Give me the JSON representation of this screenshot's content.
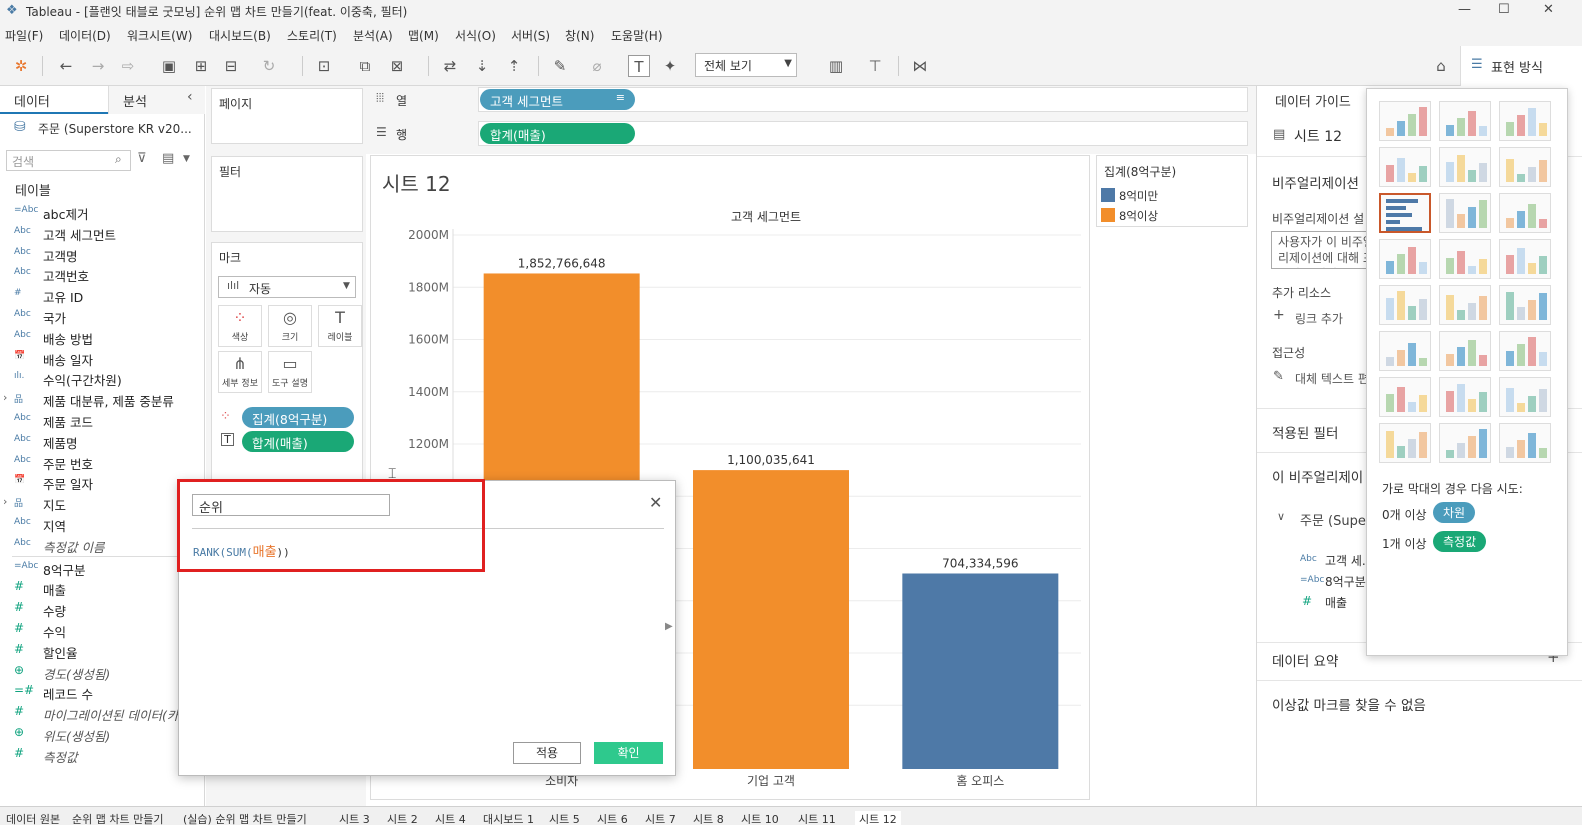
{
  "window": {
    "title": "Tableau - [플랜잇 태블로 굿모닝] 순위 맵 차트 만들기(feat. 이중축, 필터)"
  },
  "menu": [
    "파일(F)",
    "데이터(D)",
    "워크시트(W)",
    "대시보드(B)",
    "스토리(T)",
    "분석(A)",
    "맵(M)",
    "서식(O)",
    "서버(S)",
    "창(N)",
    "도움말(H)"
  ],
  "toolbar": {
    "view_select": "전체 보기",
    "show_me_label": "표현 방식"
  },
  "left": {
    "tab_data": "데이터",
    "tab_analysis": "분석",
    "datasource": "주문 (Superstore KR v20...",
    "search_placeholder": "검색",
    "tables_title": "테이블",
    "fields": [
      {
        "icon": "=Abc",
        "name": "abc제거",
        "kind": "dim"
      },
      {
        "icon": "Abc",
        "name": "고객 세그먼트",
        "kind": "dim"
      },
      {
        "icon": "Abc",
        "name": "고객명",
        "kind": "dim"
      },
      {
        "icon": "Abc",
        "name": "고객번호",
        "kind": "dim"
      },
      {
        "icon": "#",
        "name": "고유 ID",
        "kind": "dim"
      },
      {
        "icon": "Abc",
        "name": "국가",
        "kind": "dim"
      },
      {
        "icon": "Abc",
        "name": "배송 방법",
        "kind": "dim"
      },
      {
        "icon": "📅",
        "name": "배송 일자",
        "kind": "dim"
      },
      {
        "icon": "ılı.",
        "name": "수익(구간차원)",
        "kind": "dim"
      },
      {
        "icon": "品",
        "name": "제품 대분류, 제품 중분류",
        "kind": "dim",
        "expand": true
      },
      {
        "icon": "Abc",
        "name": "제품 코드",
        "kind": "dim"
      },
      {
        "icon": "Abc",
        "name": "제품명",
        "kind": "dim"
      },
      {
        "icon": "Abc",
        "name": "주문 번호",
        "kind": "dim"
      },
      {
        "icon": "📅",
        "name": "주문 일자",
        "kind": "dim"
      },
      {
        "icon": "品",
        "name": "지도",
        "kind": "dim",
        "expand": true
      },
      {
        "icon": "Abc",
        "name": "지역",
        "kind": "dim"
      },
      {
        "icon": "Abc",
        "name": "측정값 이름",
        "kind": "dim",
        "italic": true
      },
      {
        "icon": "=Abc",
        "name": "8억구분",
        "kind": "dim"
      },
      {
        "icon": "#",
        "name": "매출",
        "kind": "mea"
      },
      {
        "icon": "#",
        "name": "수량",
        "kind": "mea"
      },
      {
        "icon": "#",
        "name": "수익",
        "kind": "mea"
      },
      {
        "icon": "#",
        "name": "할인율",
        "kind": "mea"
      },
      {
        "icon": "⊕",
        "name": "경도(생성됨)",
        "kind": "mea",
        "italic": true
      },
      {
        "icon": "=#",
        "name": "레코드 수",
        "kind": "mea"
      },
      {
        "icon": "#",
        "name": "마이그레이션된 데이터(카",
        "kind": "mea",
        "italic": true
      },
      {
        "icon": "⊕",
        "name": "위도(생성됨)",
        "kind": "mea",
        "italic": true
      },
      {
        "icon": "#",
        "name": "측정값",
        "kind": "mea",
        "italic": true
      }
    ]
  },
  "shelves": {
    "pages_title": "페이지",
    "filters_title": "필터",
    "marks_title": "마크",
    "marks_type": "자동",
    "marks_buttons": [
      "색상",
      "크기",
      "레이블",
      "세부 정보",
      "도구 설명"
    ],
    "marks_pills": [
      "집계(8억구분)",
      "합계(매출)"
    ],
    "columns_label": "열",
    "rows_label": "행",
    "columns_pill": "고객 세그먼트",
    "rows_pill": "합계(매출)"
  },
  "sheet": {
    "title": "시트 12",
    "header": "고객 세그먼트"
  },
  "chart_data": {
    "type": "bar",
    "title": "시트 12",
    "xlabel": "고객 세그먼트",
    "ylabel": "",
    "categories": [
      "소비자",
      "기업 고객",
      "홈 오피스"
    ],
    "values": [
      1852766648,
      1100035641,
      704334596
    ],
    "value_labels": [
      "1,852,766,648",
      "1,100,035,641",
      "704,334,596"
    ],
    "colors": [
      "#f28e2b",
      "#f28e2b",
      "#4e79a7"
    ],
    "yticks": [
      "2000M",
      "1800M",
      "1600M",
      "1400M",
      "1200M"
    ],
    "ylim": [
      0,
      2000000000
    ],
    "grid": true
  },
  "legend": {
    "title": "집계(8억구분)",
    "items": [
      {
        "label": "8억미만",
        "color": "#4e79a7"
      },
      {
        "label": "8억이상",
        "color": "#f28e2b"
      }
    ]
  },
  "dialog": {
    "name_value": "순위",
    "formula_prefix": "RANK(SUM(",
    "formula_field": "매출",
    "formula_suffix": "))",
    "apply": "적용",
    "ok": "확인"
  },
  "guide": {
    "title": "데이터 가이드",
    "sheet": "시트 12",
    "viz_section": "비주얼리제이션",
    "viz_desc_label": "비주얼리제이션 설",
    "viz_desc_placeholder": "사용자가 이 비주얼리제이션에 대해 표시되는 설명을 입력",
    "resources": "추가 리소스",
    "add_link": "링크 추가",
    "access": "접근성",
    "alt_text": "대체 텍스트 편",
    "applied_filters": "적용된 필터",
    "this_viz": "이 비주얼리제이",
    "source": "주문 (Supe",
    "source_fields": [
      {
        "icon": "Abc",
        "name": "고객 세..."
      },
      {
        "icon": "=Abc",
        "name": "8억구분"
      },
      {
        "icon": "#",
        "name": "매출"
      }
    ],
    "data_summary": "데이터 요약",
    "no_outliers": "이상값 마크를 찾을 수 없음"
  },
  "showme": {
    "hint": "가로 막대의 경우 다음 시도:",
    "dim_req": "0개 이상",
    "dim_pill": "차원",
    "mea_req": "1개 이상",
    "mea_pill": "측정값"
  },
  "status": {
    "tabs": [
      "데이터 원본",
      "순위 맵 차트 만들기",
      "(실습) 순위 맵 차트 만들기",
      "시트 3",
      "시트 2",
      "시트 4",
      "대시보드 1",
      "시트 5",
      "시트 6",
      "시트 7",
      "시트 8",
      "시트 10",
      "시트 11",
      "시트 12"
    ]
  }
}
